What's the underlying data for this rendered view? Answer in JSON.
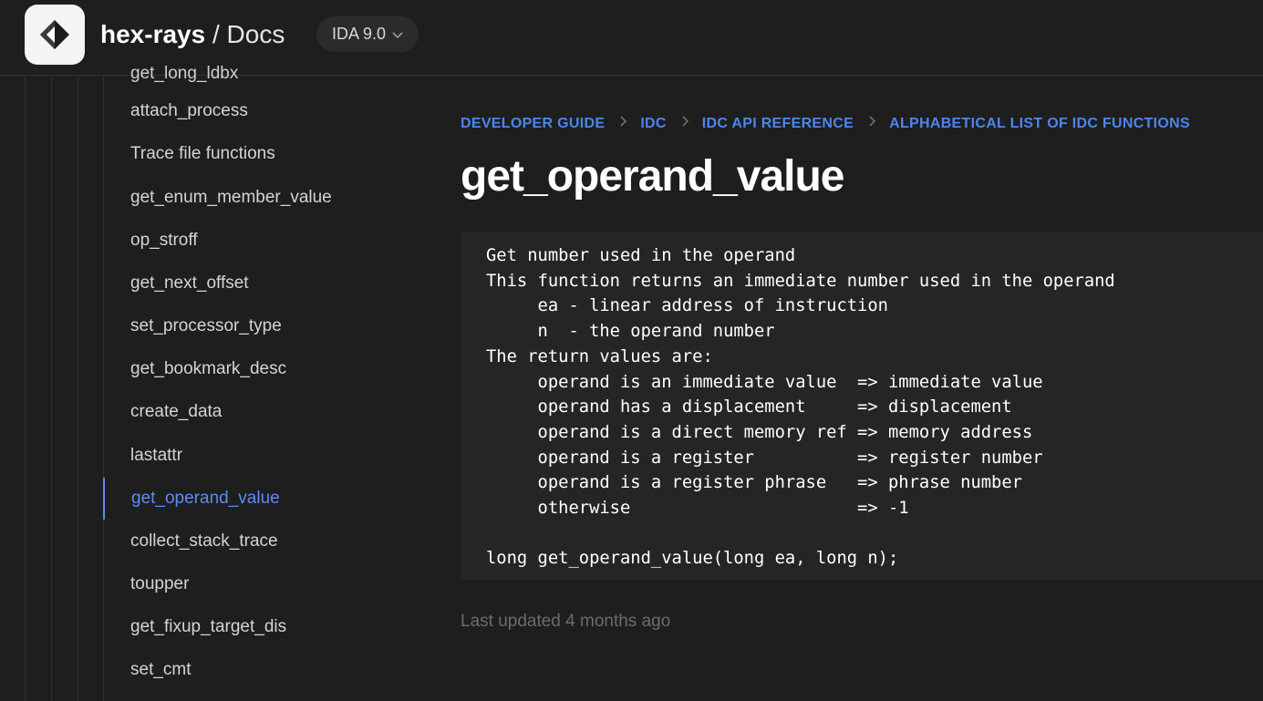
{
  "header": {
    "brand_name": "hex-rays",
    "brand_sep": " / ",
    "section": "Docs",
    "version": "IDA 9.0",
    "logo_icon": "hex-rays-logo-icon",
    "version_icon": "chevron-down-icon"
  },
  "sidebar": {
    "cut_item": "get_long_ldbx",
    "items": [
      {
        "label": "attach_process",
        "active": false
      },
      {
        "label": "Trace file functions",
        "active": false
      },
      {
        "label": "get_enum_member_value",
        "active": false
      },
      {
        "label": "op_stroff",
        "active": false
      },
      {
        "label": "get_next_offset",
        "active": false
      },
      {
        "label": "set_processor_type",
        "active": false
      },
      {
        "label": "get_bookmark_desc",
        "active": false
      },
      {
        "label": "create_data",
        "active": false
      },
      {
        "label": "lastattr",
        "active": false
      },
      {
        "label": "get_operand_value",
        "active": true
      },
      {
        "label": "collect_stack_trace",
        "active": false
      },
      {
        "label": "toupper",
        "active": false
      },
      {
        "label": "get_fixup_target_dis",
        "active": false
      },
      {
        "label": "set_cmt",
        "active": false
      }
    ]
  },
  "breadcrumb": [
    "DEVELOPER GUIDE",
    "IDC",
    "IDC API REFERENCE",
    "ALPHABETICAL LIST OF IDC FUNCTIONS"
  ],
  "page": {
    "title": "get_operand_value",
    "code": "Get number used in the operand\nThis function returns an immediate number used in the operand\n     ea - linear address of instruction\n     n  - the operand number\nThe return values are:\n     operand is an immediate value  => immediate value\n     operand has a displacement     => displacement\n     operand is a direct memory ref => memory address\n     operand is a register          => register number\n     operand is a register phrase   => phrase number\n     otherwise                      => -1\n\nlong get_operand_value(long ea, long n);",
    "last_updated": "Last updated 4 months ago"
  },
  "colors": {
    "accent": "#5b8def",
    "breadcrumb": "#4d86e8",
    "background": "#1e1e1f",
    "code_bg": "#252527"
  }
}
